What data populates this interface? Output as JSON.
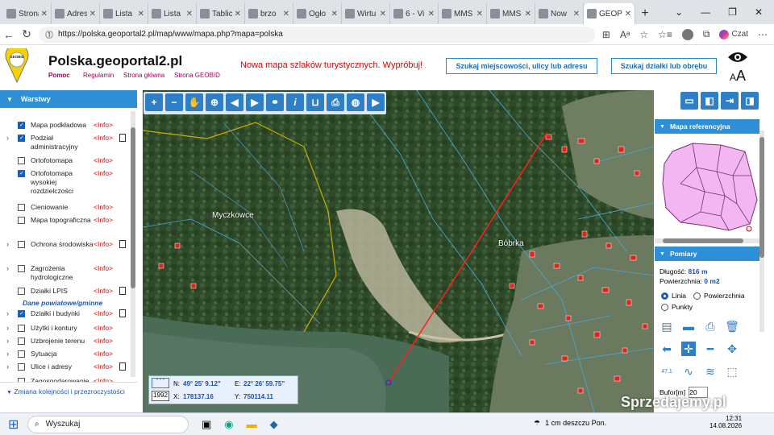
{
  "browser": {
    "tabs": [
      {
        "label": "Strona",
        "icon": "doc-icon"
      },
      {
        "label": "Adres",
        "icon": "a-icon"
      },
      {
        "label": "Lista",
        "icon": "list-icon"
      },
      {
        "label": "Lista",
        "icon": "list-icon"
      },
      {
        "label": "Tablic",
        "icon": "arrow-icon"
      },
      {
        "label": "brzo",
        "icon": "globe-icon"
      },
      {
        "label": "Ogło",
        "icon": "olx-icon"
      },
      {
        "label": "Wirtu",
        "icon": "w-icon"
      },
      {
        "label": "6 - Vi",
        "icon": "doc-icon"
      },
      {
        "label": "MMS",
        "icon": "m-icon"
      },
      {
        "label": "MMS",
        "icon": "m-icon"
      },
      {
        "label": "Now",
        "icon": "mail-icon"
      },
      {
        "label": "GEOP",
        "icon": "g-icon"
      }
    ],
    "url": "https://polska.geoportal2.pl/map/www/mapa.php?mapa=polska",
    "copilot_label": "Czat"
  },
  "header": {
    "site_name": "Polska.geoportal2.pl",
    "links": [
      "Pomoc",
      "Regulamin",
      "Strona główna",
      "Strona GEOBID"
    ],
    "logo_text": "GEOBID",
    "promo": "Nowa mapa szlaków turystycznych. Wypróbuj!",
    "search_place_btn": "Szukaj miejscowości, ulicy lub adresu",
    "search_parcel_btn": "Szukaj działki lub obrębu",
    "font_size_label": "AA"
  },
  "layers_panel": {
    "title": "Warstwy",
    "dane_label": "Dane powiatowe/gminne",
    "info_label": "<Info>",
    "items": [
      {
        "name": "Mapa podkładowa",
        "checked": true,
        "expand": false,
        "doc": false
      },
      {
        "name": "Podział administracyjny",
        "checked": true,
        "expand": true,
        "doc": true
      },
      {
        "name": "Ortofotomapa",
        "checked": false,
        "expand": false,
        "doc": false
      },
      {
        "name": "Ortofotomapa wysokiej rozdzielczości",
        "checked": true,
        "expand": false,
        "doc": false
      },
      {
        "name": "Cieniowanie",
        "checked": false,
        "expand": false,
        "doc": false
      },
      {
        "name": "Mapa topograficzna",
        "checked": false,
        "expand": false,
        "doc": false
      },
      {
        "name": "Ochrona środowiska",
        "checked": false,
        "expand": true,
        "doc": true
      },
      {
        "name": "Zagrożenia hydrologiczne",
        "checked": false,
        "expand": true,
        "doc": false
      },
      {
        "name": "Działki LPIS",
        "checked": false,
        "expand": false,
        "doc": true
      },
      {
        "name": "Działki i budynki",
        "checked": true,
        "expand": true,
        "doc": true
      },
      {
        "name": "Użytki i kontury",
        "checked": false,
        "expand": true,
        "doc": false
      },
      {
        "name": "Uzbrojenie terenu",
        "checked": false,
        "expand": true,
        "doc": false
      },
      {
        "name": "Sytuacja",
        "checked": false,
        "expand": true,
        "doc": false
      },
      {
        "name": "Ulice i adresy",
        "checked": false,
        "expand": true,
        "doc": true
      },
      {
        "name": "Zagospodarowanie",
        "checked": false,
        "expand": false,
        "doc": false
      }
    ],
    "zmiana_label": "Zmiana kolejności i przezroczystości"
  },
  "map": {
    "labels": [
      "Myczkowce",
      "Bóbrka"
    ],
    "coords": {
      "n_label": "N:",
      "n_val": "49° 25' 9.12\"",
      "e_label": "E:",
      "e_val": "22° 26' 59.75\"",
      "sys": "1992",
      "x_label": "X:",
      "x_val": "178137.16",
      "y_label": "Y:",
      "y_val": "750114.11",
      "stars": "* * *"
    }
  },
  "right_panel": {
    "ref_title": "Mapa referencyjna",
    "measure_title": "Pomiary",
    "length_label": "Długość:",
    "length_val": "816 m",
    "area_label": "Powierzchnia:",
    "area_val": "0 m2",
    "opt_line": "Linia",
    "opt_area": "Powierzchnia",
    "opt_points": "Punkty",
    "buffer_label": "Bufor[m]",
    "buffer_val": "20",
    "scale_label": "47.1"
  },
  "taskbar": {
    "search_placeholder": "Wyszukaj",
    "weather": "1 cm deszczu Pon.",
    "time": "12:31",
    "date": "14.08.2026"
  },
  "watermark": "Sprzedajemy.pl",
  "colors": {
    "accent": "#2e8fd6",
    "info": "#dd0000",
    "link": "#a0005a"
  }
}
